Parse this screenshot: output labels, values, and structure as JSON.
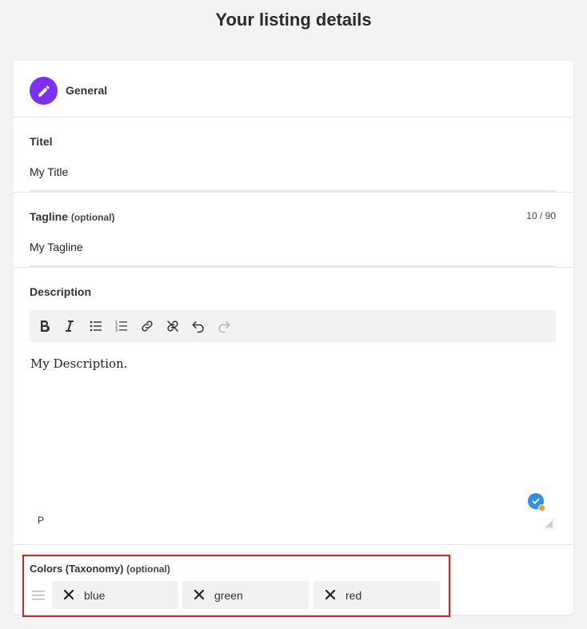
{
  "page": {
    "title": "Your listing details"
  },
  "section": {
    "name": "General",
    "icon": "pencil-icon",
    "icon_color": "#7b2ff7"
  },
  "fields": {
    "title": {
      "label": "Titel",
      "value": "My Title"
    },
    "tagline": {
      "label": "Tagline",
      "optional": "(optional)",
      "value": "My Tagline",
      "counter": "10 / 90"
    },
    "description": {
      "label": "Description",
      "toolbar": [
        "bold-icon",
        "italic-icon",
        "bullet-list-icon",
        "numbered-list-icon",
        "link-icon",
        "unlink-icon",
        "undo-icon",
        "redo-icon"
      ],
      "content": "My Description.",
      "path": "P"
    },
    "colors": {
      "label": "Colors (Taxonomy)",
      "optional": "(optional)",
      "chips": [
        "blue",
        "green",
        "red"
      ]
    }
  },
  "colors": {
    "accent": "#7b2ff7",
    "highlight": "#e01b1b",
    "grammar": "#2f8fe6"
  }
}
